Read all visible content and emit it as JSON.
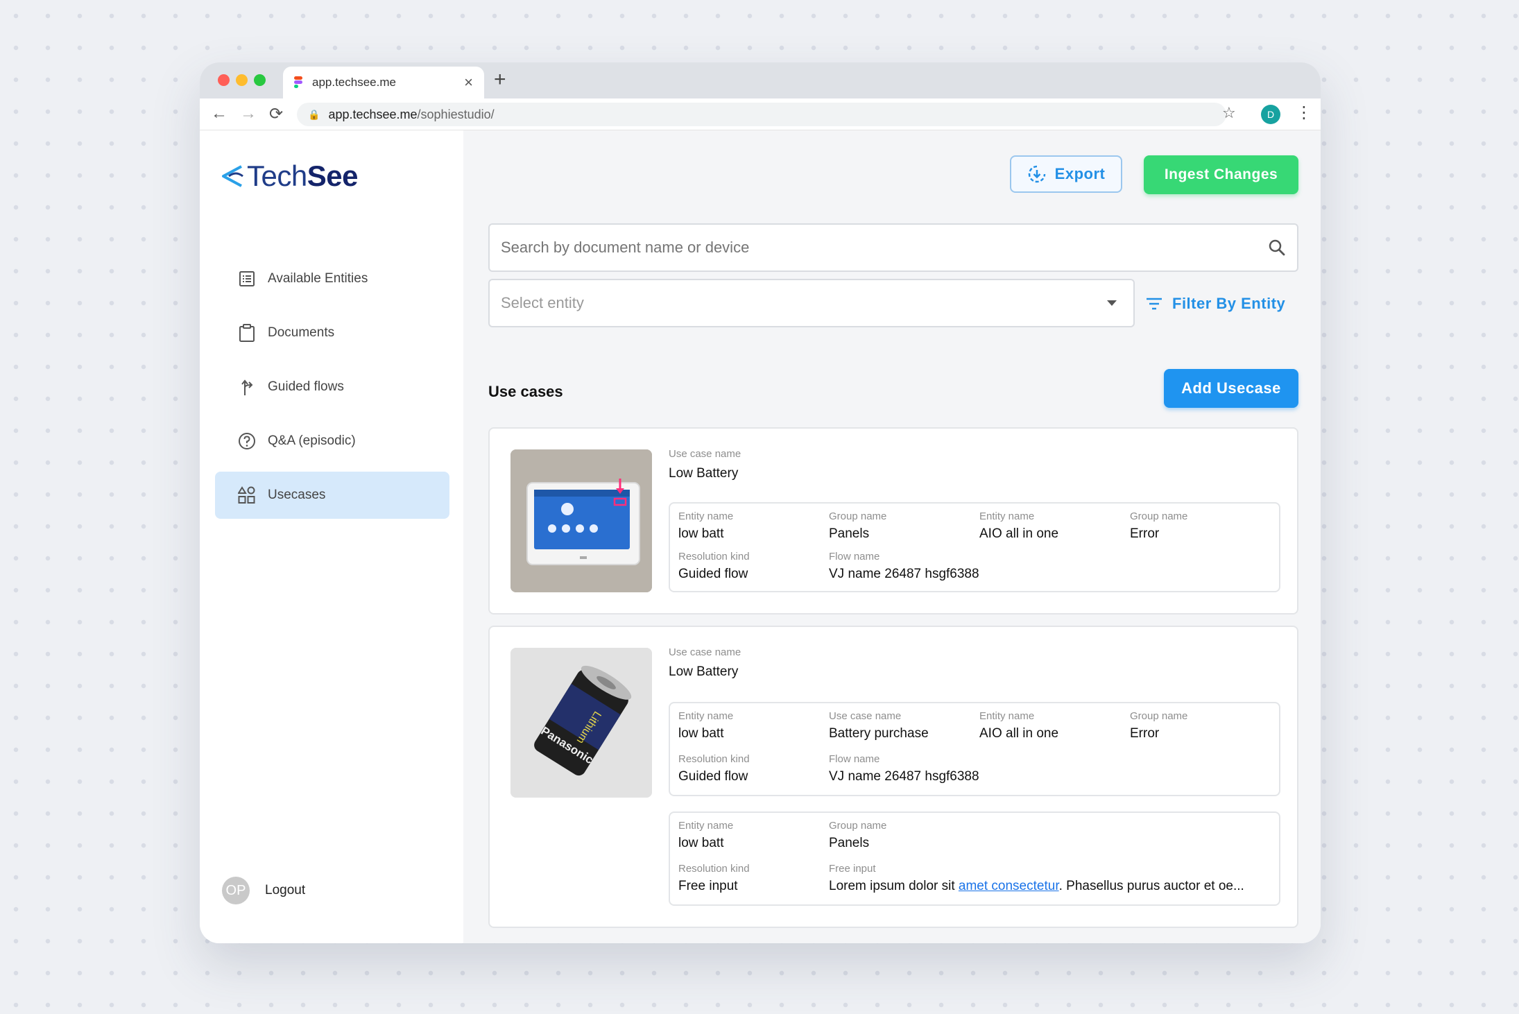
{
  "browser": {
    "tab_title": "app.techsee.me",
    "new_tab": "+",
    "url_domain": "app.techsee.me",
    "url_path": "/sophiestudio/",
    "profile_initial": "D"
  },
  "sidebar": {
    "logo": {
      "part1": "Tech",
      "part2": "See"
    },
    "items": [
      {
        "label": "Available Entities",
        "icon": "list-icon"
      },
      {
        "label": "Documents",
        "icon": "clipboard-icon"
      },
      {
        "label": "Guided flows",
        "icon": "flow-icon"
      },
      {
        "label": "Q&A (episodic)",
        "icon": "question-icon"
      },
      {
        "label": "Usecases",
        "icon": "shapes-icon",
        "active": true
      }
    ],
    "avatar_initials": "OP",
    "logout_label": "Logout"
  },
  "toolbar": {
    "export_label": "Export",
    "ingest_label": "Ingest Changes"
  },
  "search": {
    "placeholder": "Search by document name or device"
  },
  "entity_select": {
    "placeholder": "Select entity"
  },
  "filter": {
    "label": "Filter By Entity"
  },
  "usecases": {
    "title": "Use cases",
    "add_label": "Add Usecase",
    "cards": [
      {
        "use_case_label": "Use case name",
        "use_case_name": "Low Battery",
        "details": [
          {
            "row1": [
              {
                "label": "Entity name",
                "value": "low batt"
              },
              {
                "label": "Group name",
                "value": "Panels"
              },
              {
                "label": "Entity name",
                "value": "AIO all in one"
              },
              {
                "label": "Group name",
                "value": "Error"
              }
            ],
            "row2": [
              {
                "label": "Resolution kind",
                "value": "Guided flow"
              },
              {
                "label": "Flow name",
                "value": "VJ name 26487 hsgf6388"
              }
            ]
          }
        ]
      },
      {
        "use_case_label": "Use case name",
        "use_case_name": "Low Battery",
        "details": [
          {
            "row1": [
              {
                "label": "Entity name",
                "value": "low batt"
              },
              {
                "label": "Use case name",
                "value": "Battery purchase"
              },
              {
                "label": "Entity name",
                "value": "AIO all in one"
              },
              {
                "label": "Group name",
                "value": "Error"
              }
            ],
            "row2": [
              {
                "label": "Resolution kind",
                "value": "Guided flow"
              },
              {
                "label": "Flow name",
                "value": "VJ name 26487 hsgf6388"
              }
            ]
          },
          {
            "row1": [
              {
                "label": "Entity name",
                "value": "low batt"
              },
              {
                "label": "Group name",
                "value": "Panels"
              }
            ],
            "row2": [
              {
                "label": "Resolution kind",
                "value": "Free input"
              },
              {
                "label": "Free input",
                "value_before": "Lorem ipsum dolor sit ",
                "value_link": "amet consectetur",
                "value_after": ". Phasellus purus auctor et oe..."
              }
            ]
          }
        ]
      }
    ]
  },
  "battery_label": {
    "brand": "Panasonic",
    "type": "Lithium"
  },
  "colors": {
    "accent_blue": "#1f94f0",
    "ingest_green": "#37d875",
    "active_nav": "#d6e9fb",
    "logo_navy": "#14246a"
  }
}
